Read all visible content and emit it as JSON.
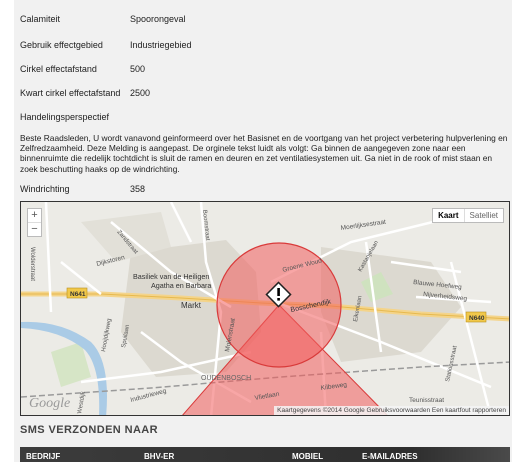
{
  "details": {
    "rows": [
      {
        "label": "Calamiteit",
        "value": "Spoorongeval"
      },
      {
        "label": "Gebruik effectgebied",
        "value": "Industriegebied"
      },
      {
        "label": "Cirkel effectafstand",
        "value": "500"
      },
      {
        "label": "Kwart cirkel effectafstand",
        "value": "2500"
      },
      {
        "label": "Handelingsperspectief",
        "value": ""
      }
    ],
    "description": "Beste Raadsleden, U wordt vanavond geinformeerd over het Basisnet en de voortgang van het project verbetering hulpverlening en Zelfredzaamheid. Deze Melding is aangepast. De orginele tekst luidt als volgt: Ga binnen de aangegeven zone naar een binnenruimte die redelijk tochtdicht is sluit de ramen en deuren en zet ventilatiesystemen uit. Ga niet in de rook of mist staan en zoek beschutting haaks op de windrichting.",
    "wind_label": "Windrichting",
    "wind_value": "358"
  },
  "map": {
    "zoom_in": "+",
    "zoom_out": "−",
    "type_map": "Kaart",
    "type_satellite": "Satelliet",
    "attribution": "Kaartgegevens ©2014 Google   Gebruiksvoorwaarden   Een kaartfout rapporteren",
    "google_logo": "Google",
    "warning_icon": "exclamation-warning-icon",
    "zone_color": "#f25c5c",
    "labels": {
      "molenkreek": "Moerlijksestraat",
      "wolderstraat": "Wolderstraat",
      "n641": "N641",
      "dijksteroren": "Dijkstoren",
      "basiliek": "Basiliek van de Heiligen",
      "agatha": "Agatha en Barbara",
      "markt": "Markt",
      "groene": "Groene Woud",
      "blauwe": "Blauwe Hoefweg",
      "nijverheid": "Nijverheidsweg",
      "bosschendijk": "Bosschendijk",
      "n640": "N640",
      "oudenbosch": "OUDENBOSCH",
      "industrieweg": "Industrieweg",
      "vlietlaan": "Vlietlaan",
      "kilbeweg": "Kilbeweg",
      "teunisstraat": "Teunisstraat",
      "eikenlaan": "Eikenlaan",
      "molenstraat": "Molenstraat",
      "spuilaan": "Spuilaan",
      "hooidijk": "Hooijdijkweg",
      "westdijk": "Westdijk",
      "boomstraat": "Boomstraat",
      "kastanjelaan": "Kastanjelaan",
      "stationsstraat": "Stationsstraat",
      "zandstraat": "Zandstraat"
    }
  },
  "sms": {
    "heading": "SMS VERZONDEN NAAR",
    "columns": [
      "BEDRIJF",
      "BHV-ER",
      "MOBIEL",
      "E-MAILADRES"
    ]
  }
}
